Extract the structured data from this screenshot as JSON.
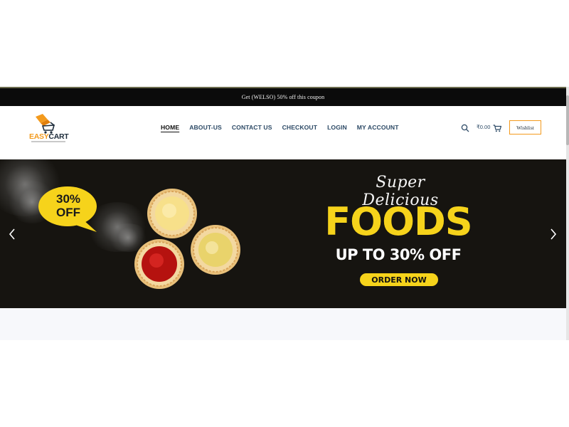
{
  "announcement": {
    "text": "Get (WELSO) 50% off this coupon"
  },
  "logo": {
    "part1": "EASY",
    "part2": "CART"
  },
  "nav": {
    "items": [
      {
        "label": "HOME",
        "active": true
      },
      {
        "label": "ABOUT-US"
      },
      {
        "label": "CONTACT US"
      },
      {
        "label": "CHECKOUT"
      },
      {
        "label": "LOGIN"
      },
      {
        "label": "MY ACCOUNT"
      }
    ]
  },
  "header_actions": {
    "search_icon": "search-icon",
    "cart_total": "₹0.00",
    "cart_icon": "cart-icon",
    "wishlist_label": "Wishlist"
  },
  "hero": {
    "badge_line1": "30%",
    "badge_line2": "OFF",
    "script_title": "Super Delicious",
    "headline": "FOODS",
    "subline": "UP TO 30% OFF",
    "cta_label": "ORDER NOW",
    "prev_icon": "chevron-left-icon",
    "next_icon": "chevron-right-icon"
  },
  "colors": {
    "accent_yellow": "#f6d31b",
    "brand_orange": "#f39a1d",
    "nav_text": "#2d4a66",
    "hero_bg": "#161410",
    "topbar_bg": "#0b0b0b"
  }
}
